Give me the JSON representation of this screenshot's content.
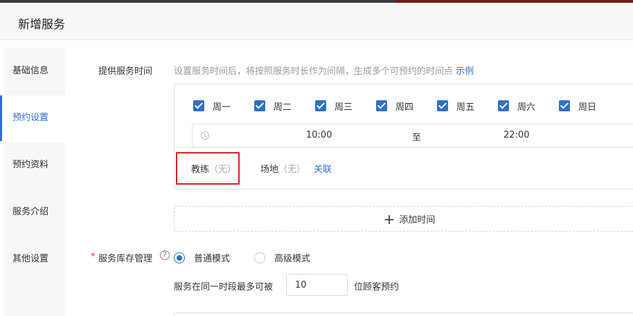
{
  "header": {
    "title": "新增服务"
  },
  "sidebar": {
    "items": [
      {
        "label": "基础信息"
      },
      {
        "label": "预约设置"
      },
      {
        "label": "预约资料"
      },
      {
        "label": "服务介绍"
      },
      {
        "label": "其他设置"
      }
    ],
    "active_index": 1
  },
  "service_time": {
    "label": "提供服务时间",
    "hint": "设置服务时间后，将按照服务时长作为间隔，生成多个可预约的时间点",
    "hint_link": "示例",
    "days": [
      {
        "label": "周一",
        "checked": true
      },
      {
        "label": "周二",
        "checked": true
      },
      {
        "label": "周三",
        "checked": true
      },
      {
        "label": "周四",
        "checked": true
      },
      {
        "label": "周五",
        "checked": true
      },
      {
        "label": "周六",
        "checked": true
      },
      {
        "label": "周日",
        "checked": true
      }
    ],
    "start_time": "10:00",
    "separator": "至",
    "end_time": "22:00",
    "coach_label": "教练",
    "coach_value": "（无）",
    "venue_label": "场地",
    "venue_value": "（无）",
    "link_label": "关联",
    "add_time_label": "添加时间"
  },
  "inventory": {
    "required_mark": "*",
    "label": "服务库存管理",
    "help_icon": "?",
    "modes": [
      {
        "label": "普通模式",
        "selected": true
      },
      {
        "label": "高级模式",
        "selected": false
      }
    ],
    "prefix": "服务在同一时段最多可被",
    "quantity": "10",
    "suffix": "位顾客预约"
  },
  "colors": {
    "accent": "#3071c4",
    "highlight_border": "#d32222",
    "required": "#ee3333"
  }
}
